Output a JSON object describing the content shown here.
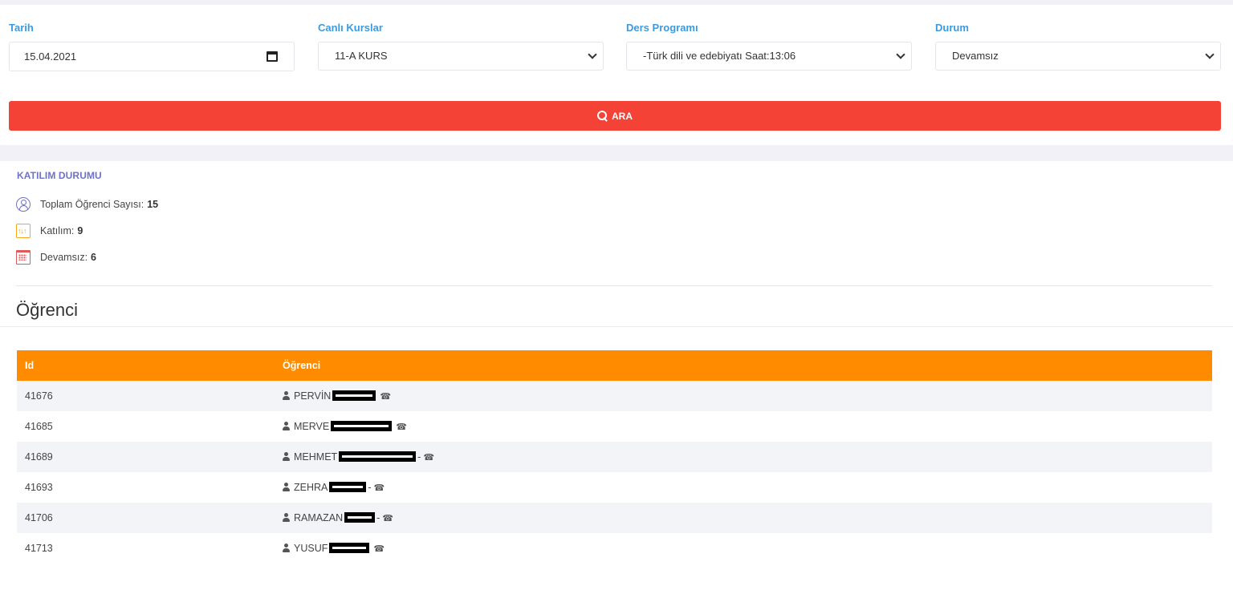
{
  "filters": {
    "date": {
      "label": "Tarih",
      "value": "15.04.2021"
    },
    "course": {
      "label": "Canlı Kurslar",
      "value": "11-A KURS"
    },
    "schedule": {
      "label": "Ders Programı",
      "value": "-Türk dili ve edebiyatı Saat:13:06"
    },
    "status": {
      "label": "Durum",
      "value": "Devamsız"
    },
    "search_label": "ARA"
  },
  "attendance": {
    "title": "KATILIM DURUMU",
    "total_label": "Toplam Öğrenci Sayısı:",
    "total_value": "15",
    "present_label": "Katılım:",
    "present_value": "9",
    "absent_label": "Devamsız:",
    "absent_value": "6"
  },
  "students": {
    "title": "Öğrenci",
    "columns": [
      "Id",
      "Öğrenci"
    ],
    "rows": [
      {
        "id": "41676",
        "name": "PERVİN",
        "dash": ""
      },
      {
        "id": "41685",
        "name": "MERVE",
        "dash": ""
      },
      {
        "id": "41689",
        "name": "MEHMET",
        "dash": "-"
      },
      {
        "id": "41693",
        "name": "ZEHRA",
        "dash": "-"
      },
      {
        "id": "41706",
        "name": "RAMAZAN",
        "dash": "-"
      },
      {
        "id": "41713",
        "name": "YUSUF",
        "dash": ""
      }
    ]
  },
  "icons": {
    "date": "calendar-icon",
    "select": "chevron-down-icon",
    "search": "search-icon",
    "total": "user-circle-icon",
    "present": "sliders-icon",
    "absent": "calendar-grid-icon",
    "student": "user-icon",
    "phone": "phone-icon"
  },
  "colors": {
    "accent_label": "#3b9be0",
    "search_button": "#f44236",
    "table_header": "#ff8c00",
    "section_title": "#6f71c8"
  }
}
